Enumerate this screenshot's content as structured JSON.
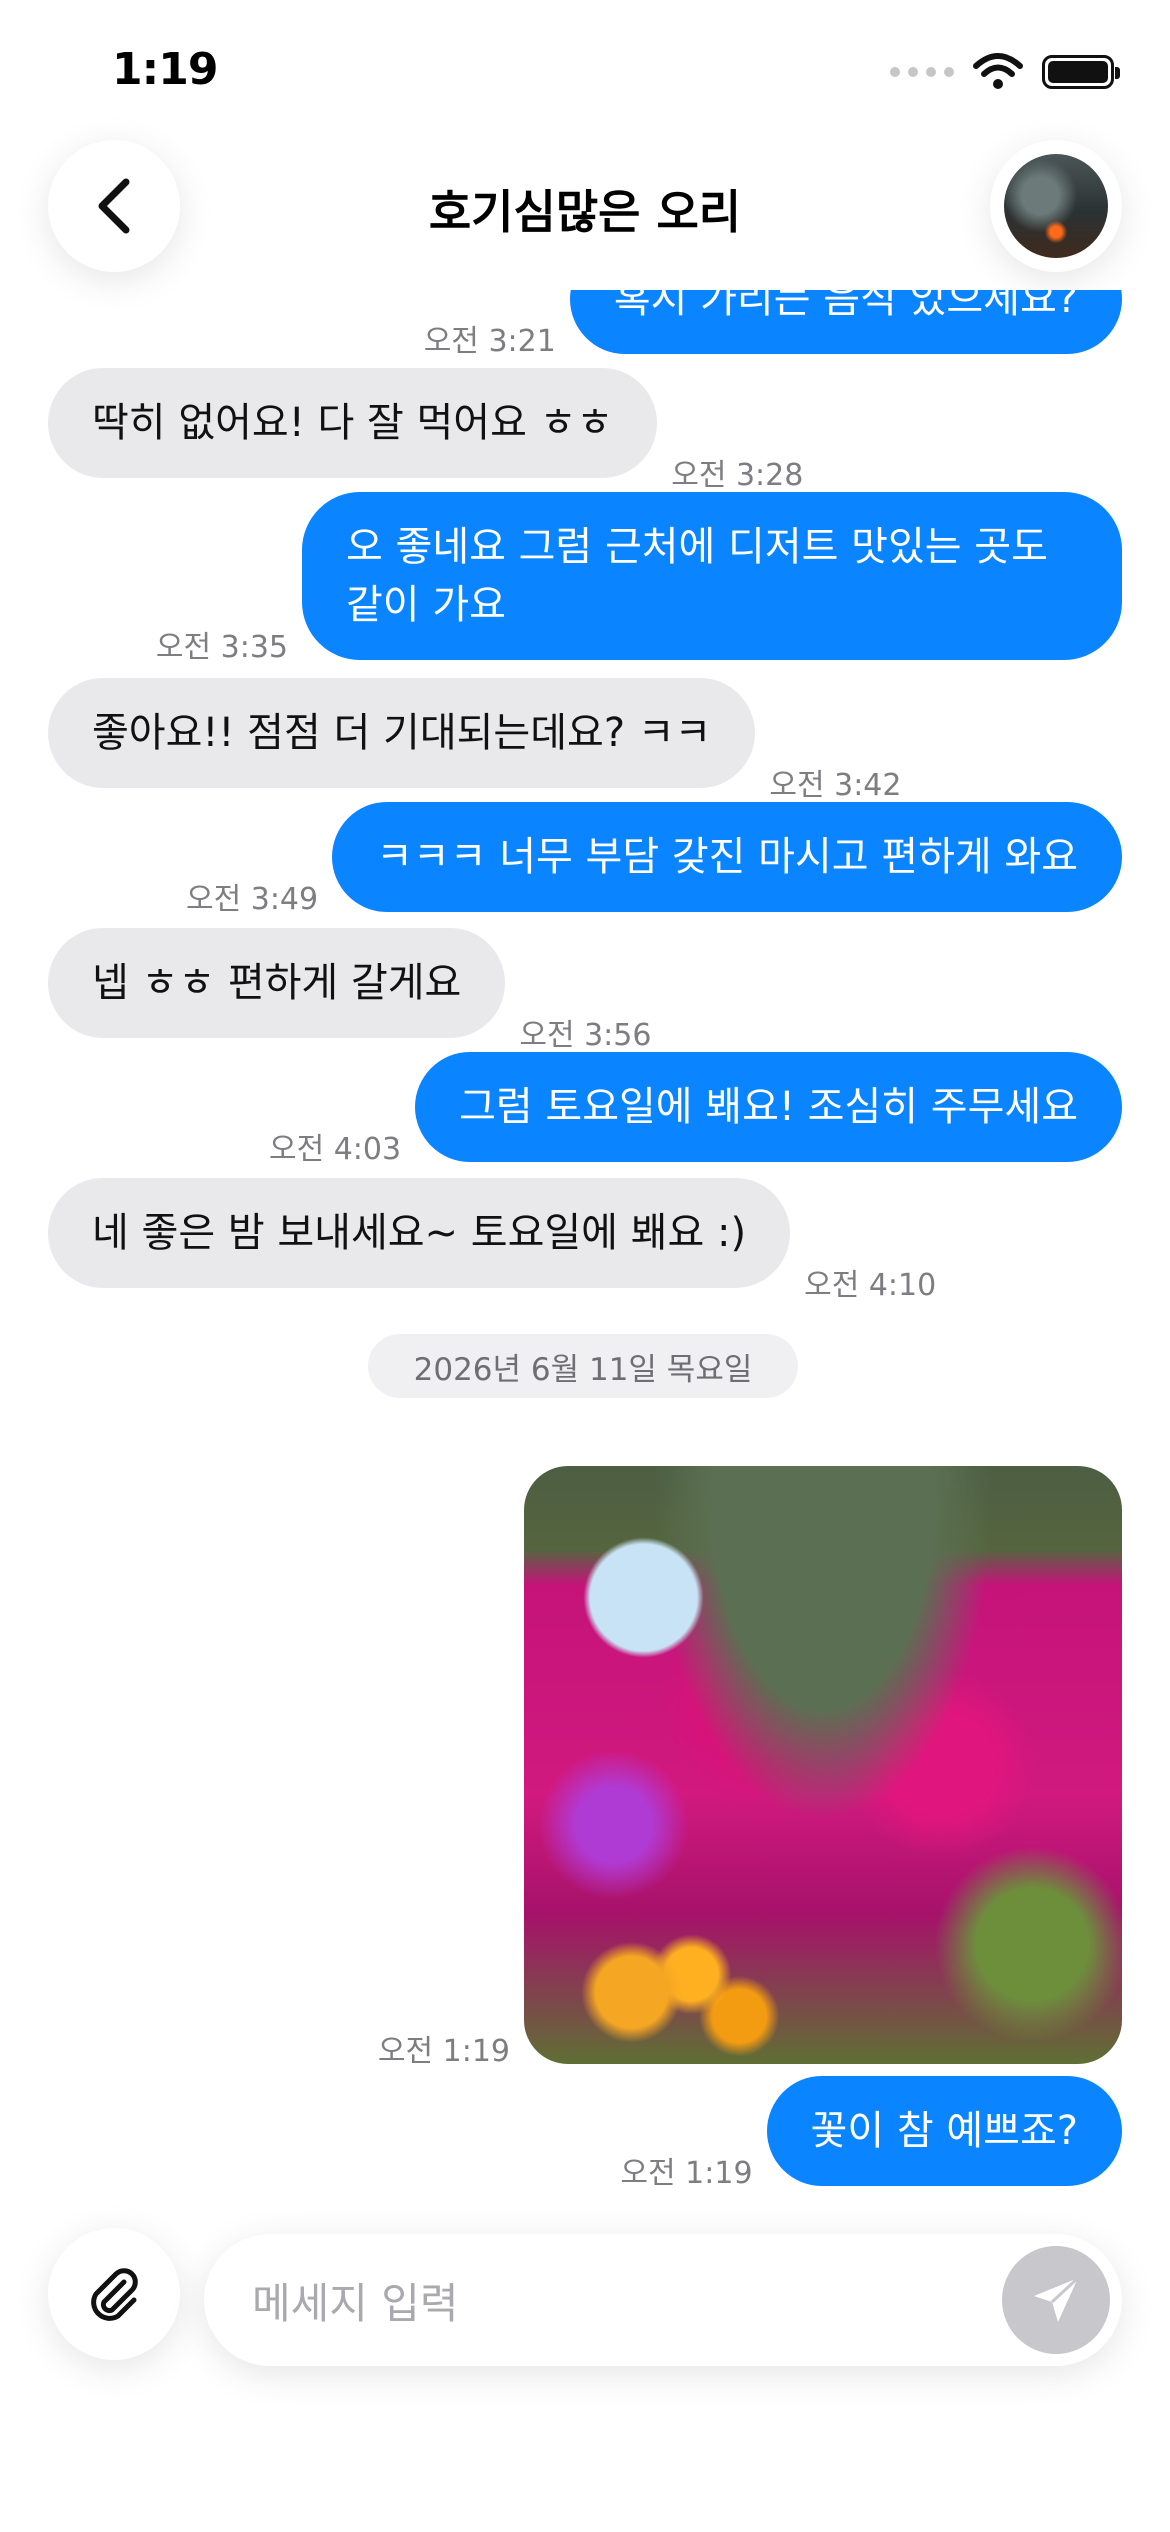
{
  "status_bar": {
    "time": "1:19"
  },
  "header": {
    "title": "호기심많은 오리"
  },
  "messages": [
    {
      "from": "me",
      "text": "혹시 가리는 음식 있으세요?",
      "time": "오전 3:21"
    },
    {
      "from": "other",
      "text": "딱히 없어요! 다 잘 먹어요 ㅎㅎ",
      "time": "오전 3:28"
    },
    {
      "from": "me",
      "text": "오 좋네요 그럼 근처에 디저트 맛있는 곳도 같이 가요",
      "time": "오전 3:35"
    },
    {
      "from": "other",
      "text": "좋아요!! 점점 더 기대되는데요? ㅋㅋ",
      "time": "오전 3:42"
    },
    {
      "from": "me",
      "text": "ㅋㅋㅋ 너무 부담 갖진 마시고 편하게 와요",
      "time": "오전 3:49"
    },
    {
      "from": "other",
      "text": "넵 ㅎㅎ 편하게 갈게요",
      "time": "오전 3:56"
    },
    {
      "from": "me",
      "text": "그럼 토요일에 봬요! 조심히 주무세요",
      "time": "오전 4:03"
    },
    {
      "from": "other",
      "text": "네 좋은 밤 보내세요~ 토요일에 봬요 :)",
      "time": "오전 4:10"
    }
  ],
  "date_divider": "2026년 6월 11일 목요일",
  "photo_message": {
    "time": "오전 1:19"
  },
  "last_message": {
    "text": "꽃이 참 예쁘죠?",
    "time": "오전 1:19"
  },
  "composer": {
    "placeholder": "메세지 입력"
  }
}
